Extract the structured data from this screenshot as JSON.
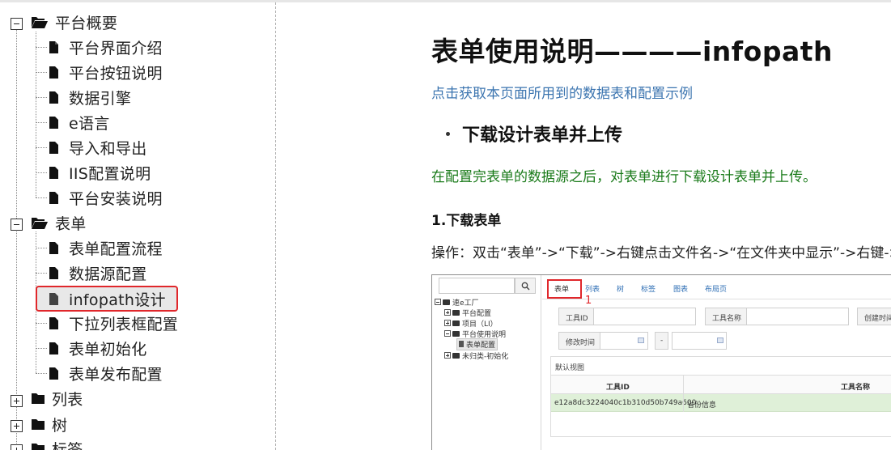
{
  "tree": {
    "groups": [
      {
        "label": "平台概要",
        "expanded": true,
        "children": [
          "平台界面介绍",
          "平台按钮说明",
          "数据引擎",
          "e语言",
          "导入和导出",
          "IIS配置说明",
          "平台安装说明"
        ]
      },
      {
        "label": "表单",
        "expanded": true,
        "children": [
          "表单配置流程",
          "数据源配置",
          "infopath设计",
          "下拉列表框配置",
          "表单初始化",
          "表单发布配置"
        ]
      },
      {
        "label": "列表",
        "expanded": false
      },
      {
        "label": "树",
        "expanded": false
      },
      {
        "label": "标签",
        "expanded": false
      }
    ],
    "selected_item": "infopath设计"
  },
  "article": {
    "title": "表单使用说明————infopath",
    "link_text": "点击获取本页面所用到的数据表和配置示例",
    "bullet_title": "下载设计表单并上传",
    "intro": "在配置完表单的数据源之后，对表单进行下载设计表单并上传。",
    "step1_title": "1.下载表单",
    "step1_text": "操作：双击“表单”->“下载”->右键点击文件名->“在文件夹中显示”->右键->“设"
  },
  "screenshot": {
    "tree": {
      "root": "速e工厂",
      "items": [
        "平台配置",
        "项目（LI）",
        "平台使用说明",
        "表单配置",
        "未归类-初始化"
      ]
    },
    "tabs": [
      "表单",
      "列表",
      "树",
      "标签",
      "图表",
      "布局页"
    ],
    "callout_number": "1",
    "filters": {
      "tool_id_label": "工具ID",
      "tool_name_label": "工具名称",
      "create_time_label": "创建时间",
      "modify_time_label": "修改时间",
      "range_separator": "-"
    },
    "panel_title": "默认视图",
    "table": {
      "headers": [
        "工具ID",
        "工具名称"
      ],
      "rows": [
        [
          "e12a8dc3224040c1b310d50b749a600",
          "省份信息"
        ]
      ]
    }
  },
  "colors": {
    "selection_border": "#e0272b",
    "link": "#3c75b0",
    "intro_text": "#197a19"
  }
}
